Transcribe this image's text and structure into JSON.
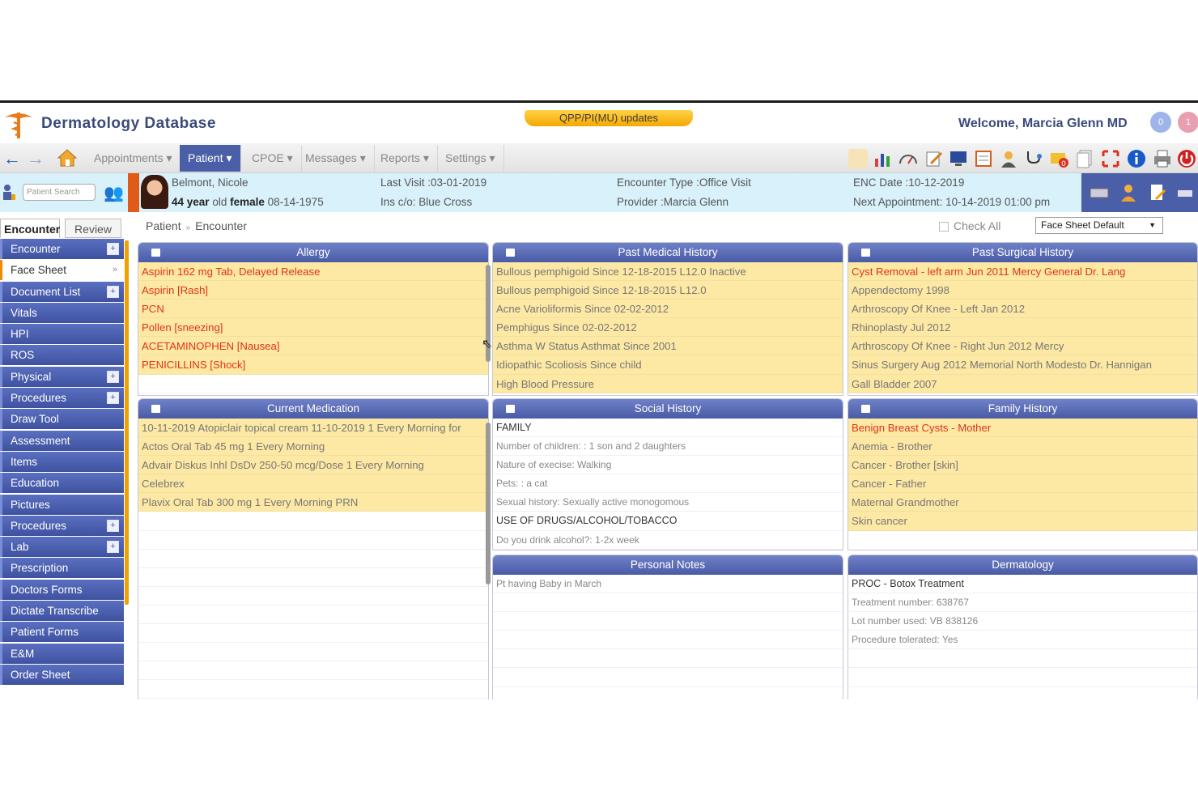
{
  "header": {
    "app_title": "Dermatology Database",
    "updates_label": "QPP/PI(MU) updates",
    "welcome": "Welcome, Marcia Glenn MD",
    "badges": [
      "0",
      "1"
    ]
  },
  "nav": {
    "menus": [
      "Appointments ▾",
      "Patient ▾",
      "CPOE ▾",
      "Messages ▾",
      "Reports ▾",
      "Settings ▾"
    ]
  },
  "patient_search": {
    "placeholder": "Patient Search"
  },
  "patient": {
    "name": "Belmont, Nicole",
    "age_text": "44 year",
    "old_text": "old",
    "gender_text": "female",
    "dob": "08-14-1975",
    "last_visit": "Last Visit :03-01-2019",
    "insurance": "Ins c/o: Blue Cross",
    "encounter_type": "Encounter Type :Office Visit",
    "provider": "Provider :Marcia Glenn",
    "enc_date": "ENC Date :10-12-2019",
    "next_appointment": "Next Appointment: 10-14-2019 01:00 pm"
  },
  "left_tabs": [
    "Encounter",
    "Review"
  ],
  "sidebar": {
    "items": [
      {
        "label": "Encounter",
        "plus": true
      },
      {
        "label": "Face Sheet",
        "active": true
      },
      {
        "label": "Document List",
        "plus": true
      },
      {
        "label": "Vitals"
      },
      {
        "label": "HPI"
      },
      {
        "label": "ROS"
      },
      {
        "label": "Physical",
        "plus": true
      },
      {
        "label": "Procedures",
        "plus": true
      },
      {
        "label": "Draw Tool"
      },
      {
        "label": "Assessment"
      },
      {
        "label": "Items"
      },
      {
        "label": "Education"
      },
      {
        "label": "Pictures"
      },
      {
        "label": "Procedures",
        "plus": true
      },
      {
        "label": "Lab",
        "plus": true
      },
      {
        "label": "Prescription"
      },
      {
        "label": "Doctors Forms"
      },
      {
        "label": "Dictate Transcribe"
      },
      {
        "label": "Patient Forms"
      },
      {
        "label": "E&M"
      },
      {
        "label": "Order Sheet"
      }
    ]
  },
  "breadcrumb": {
    "root": "Patient",
    "current": "Encounter"
  },
  "check_all": "Check All",
  "face_sheet_select": "Face Sheet Default",
  "panels": {
    "allergy": {
      "title": "Allergy",
      "rows": [
        {
          "text": "Aspirin 162 mg Tab, Delayed Release",
          "red": true
        },
        {
          "text": "Aspirin [Rash]",
          "red": true
        },
        {
          "text": "PCN",
          "red": true
        },
        {
          "text": "Pollen [sneezing]",
          "red": true
        },
        {
          "text": "ACETAMINOPHEN [Nausea]",
          "red": true
        },
        {
          "text": "PENICILLINS [Shock]",
          "red": true
        }
      ]
    },
    "past_medical": {
      "title": "Past Medical History",
      "rows": [
        {
          "text": "Bullous pemphigoid Since 12-18-2015 L12.0 Inactive"
        },
        {
          "text": "Bullous pemphigoid Since 12-18-2015 L12.0"
        },
        {
          "text": "Acne Varioliformis Since 02-02-2012"
        },
        {
          "text": "Pemphigus Since 02-02-2012"
        },
        {
          "text": "Asthma W Status Asthmat Since 2001"
        },
        {
          "text": "Idiopathic Scoliosis Since child"
        },
        {
          "text": "High Blood Pressure"
        }
      ]
    },
    "past_surgical": {
      "title": "Past Surgical History",
      "rows": [
        {
          "text": "Cyst Removal - left arm Jun 2011 Mercy General Dr. Lang",
          "red": true
        },
        {
          "text": "Appendectomy 1998"
        },
        {
          "text": "Arthroscopy Of Knee - Left Jan 2012"
        },
        {
          "text": "Rhinoplasty Jul 2012"
        },
        {
          "text": "Arthroscopy Of Knee - Right Jun 2012 Mercy"
        },
        {
          "text": "Sinus Surgery Aug 2012 Memorial North Modesto Dr. Hannigan"
        },
        {
          "text": "Gall Bladder 2007"
        }
      ]
    },
    "current_medication": {
      "title": "Current Medication",
      "rows": [
        {
          "text": "10-11-2019 Atopiclair topical cream 11-10-2019 1 Every Morning for"
        },
        {
          "text": "Actos Oral Tab 45 mg 1 Every Morning"
        },
        {
          "text": "Advair Diskus Inhl DsDv 250-50 mcg/Dose 1 Every Morning"
        },
        {
          "text": "Celebrex"
        },
        {
          "text": "Plavix Oral Tab 300 mg 1 Every Morning PRN"
        }
      ]
    },
    "social_history": {
      "title": "Social History",
      "rows": [
        {
          "text": "FAMILY",
          "kind": "head"
        },
        {
          "text": "Number of children: : 1 son and 2 daughters",
          "kind": "small"
        },
        {
          "text": "Nature of execise: Walking",
          "kind": "small"
        },
        {
          "text": "Pets: : a cat",
          "kind": "small"
        },
        {
          "text": "Sexual history: Sexually active monogomous",
          "kind": "small"
        },
        {
          "text": "USE OF DRUGS/ALCOHOL/TOBACCO",
          "kind": "head"
        },
        {
          "text": "Do you drink alcohol?: 1-2x week",
          "kind": "small"
        }
      ]
    },
    "family_history": {
      "title": "Family History",
      "rows": [
        {
          "text": "Benign Breast Cysts - Mother",
          "red": true
        },
        {
          "text": "Anemia - Brother"
        },
        {
          "text": "Cancer - Brother [skin]"
        },
        {
          "text": "Cancer - Father"
        },
        {
          "text": "Maternal Grandmother"
        },
        {
          "text": "Skin cancer"
        }
      ]
    },
    "personal_notes": {
      "title": "Personal Notes",
      "rows": [
        {
          "text": "Pt having Baby in March",
          "kind": "small"
        }
      ]
    },
    "dermatology": {
      "title": "Dermatology",
      "rows": [
        {
          "text": "PROC - Botox Treatment",
          "kind": "head"
        },
        {
          "text": "Treatment number: 638767",
          "kind": "small"
        },
        {
          "text": "Lot number used: VB 838126",
          "kind": "small"
        },
        {
          "text": "Procedure tolerated: Yes",
          "kind": "small"
        }
      ]
    }
  },
  "colors": {
    "brand_blue": "#4a5fa8",
    "row_highlight": "#fde8a4",
    "alert_red": "#e0341a",
    "patient_bar": "#d8f1fa",
    "accent_orange": "#f0a000"
  }
}
